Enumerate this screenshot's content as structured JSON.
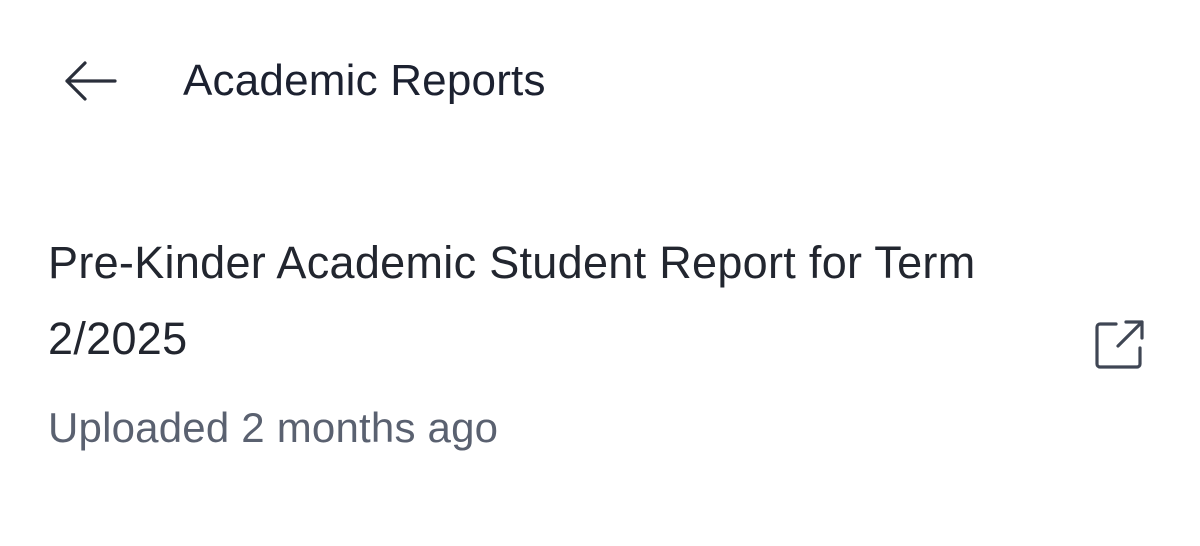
{
  "header": {
    "back_icon": "arrow-left-icon",
    "title": "Academic Reports"
  },
  "reports": [
    {
      "title": "Pre-Kinder Academic Student Report for Term 2/2025",
      "uploaded": "Uploaded 2 months ago",
      "action_icon": "external-link-icon"
    }
  ],
  "colors": {
    "text_primary": "#1c2130",
    "text_secondary": "#5a6170",
    "icon": "#3f4654",
    "background": "#ffffff"
  }
}
